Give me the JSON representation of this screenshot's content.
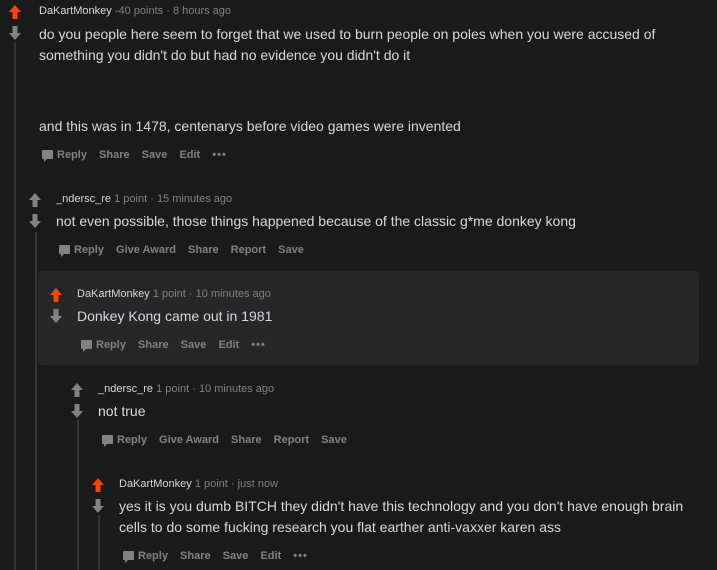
{
  "colors": {
    "background": "#1a1a1b",
    "highlight": "#272729",
    "upvote_active": "#ff4500",
    "muted": "#818384",
    "text": "#d7dadc"
  },
  "comments": [
    {
      "author": "DaKartMonkey",
      "points": "-40 points",
      "time": "8 hours ago",
      "paragraphs": [
        "do you people here seem to forget that we used to burn people on poles when you were accused of something you didn't do but had no evidence you didn't do it",
        "and this was in 1478, centenarys before video games were invented"
      ],
      "actions": [
        "Reply",
        "Share",
        "Save",
        "Edit",
        "•••"
      ],
      "upvoted": true
    },
    {
      "author": "_ndersc_re",
      "points": "1 point",
      "time": "15 minutes ago",
      "paragraphs": [
        "not even possible, those things happened because of the classic g*me donkey kong"
      ],
      "actions": [
        "Reply",
        "Give Award",
        "Share",
        "Report",
        "Save"
      ],
      "upvoted": false
    },
    {
      "author": "DaKartMonkey",
      "points": "1 point",
      "time": "10 minutes ago",
      "paragraphs": [
        "Donkey Kong came out in 1981"
      ],
      "actions": [
        "Reply",
        "Share",
        "Save",
        "Edit",
        "•••"
      ],
      "upvoted": true
    },
    {
      "author": "_ndersc_re",
      "points": "1 point",
      "time": "10 minutes ago",
      "paragraphs": [
        "not true"
      ],
      "actions": [
        "Reply",
        "Give Award",
        "Share",
        "Report",
        "Save"
      ],
      "upvoted": false
    },
    {
      "author": "DaKartMonkey",
      "points": "1 point",
      "time": "just now",
      "paragraphs": [
        "yes it is you dumb BITCH they didn't have this technology and you don't have enough brain cells to do some fucking research you flat earther anti-vaxxer karen ass"
      ],
      "actions": [
        "Reply",
        "Share",
        "Save",
        "Edit",
        "•••"
      ],
      "upvoted": true
    }
  ]
}
